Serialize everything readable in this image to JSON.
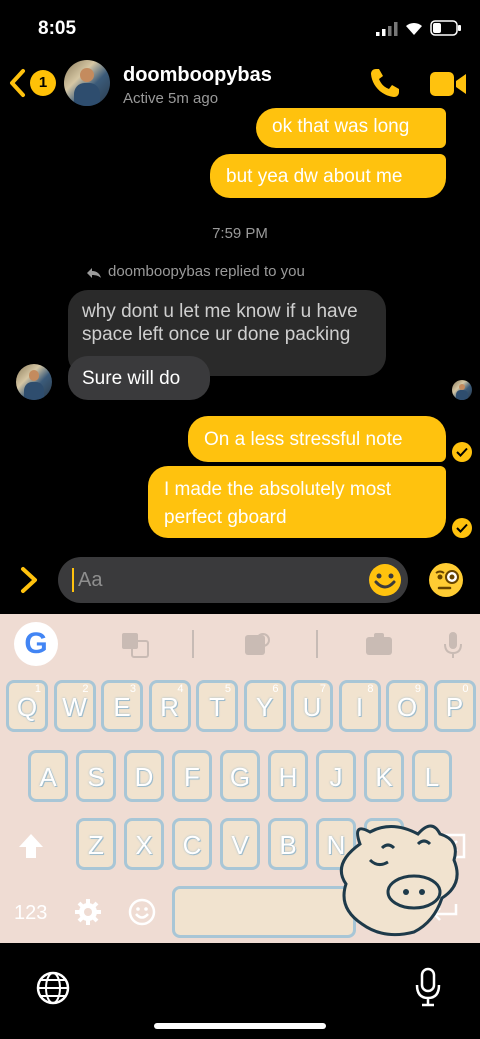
{
  "status_bar": {
    "time": "8:05"
  },
  "header": {
    "back_badge": "1",
    "name": "doomboopybas",
    "subtitle": "Active 5m ago"
  },
  "messages": {
    "m1": "ok that was long",
    "m2": "but yea dw about me",
    "timestamp": "7:59 PM",
    "replied_label": "doomboopybas replied to you",
    "quoted": "why dont u let me know if u have space left once ur done packing",
    "m3": "Sure will do",
    "m4": "On a less stressful note",
    "m5": "I made the absolutely most perfect gboard"
  },
  "composer": {
    "placeholder": "Aa"
  },
  "keyboard": {
    "row1": [
      {
        "k": "Q",
        "n": "1"
      },
      {
        "k": "W",
        "n": "2"
      },
      {
        "k": "E",
        "n": "3"
      },
      {
        "k": "R",
        "n": "4"
      },
      {
        "k": "T",
        "n": "5"
      },
      {
        "k": "Y",
        "n": "6"
      },
      {
        "k": "U",
        "n": "7"
      },
      {
        "k": "I",
        "n": "8"
      },
      {
        "k": "O",
        "n": "9"
      },
      {
        "k": "P",
        "n": "0"
      }
    ],
    "row2": [
      "A",
      "S",
      "D",
      "F",
      "G",
      "H",
      "J",
      "K",
      "L"
    ],
    "row3": [
      "Z",
      "X",
      "C",
      "V",
      "B",
      "N",
      "M"
    ],
    "numbers_label": "123",
    "period": "."
  },
  "colors": {
    "accent": "#ffc20e",
    "keyboard_bg": "#efdcd3",
    "key_border": "#a8c6d6"
  },
  "icons": [
    "chevron-left-icon",
    "phone-icon",
    "video-icon",
    "reply-icon",
    "check-icon",
    "expand-icon",
    "smile-icon",
    "monocle-emoji-icon",
    "google-icon",
    "translate-icon",
    "sticker-icon",
    "gif-icon",
    "mic-icon",
    "shift-icon",
    "backspace-icon",
    "settings-icon",
    "emoji-icon",
    "enter-icon",
    "globe-icon"
  ]
}
